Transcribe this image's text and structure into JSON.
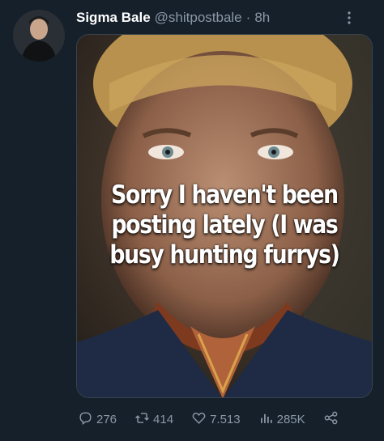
{
  "tweet": {
    "author_name": "Sigma Bale",
    "handle": "@shitpostbale",
    "separator": "·",
    "time": "8h",
    "media_caption": "Sorry I haven't been posting lately (I was busy hunting furrys)"
  },
  "actions": {
    "replies": "276",
    "retweets": "414",
    "likes": "7.513",
    "views": "285K"
  },
  "icons": {
    "more": "more-options-icon",
    "reply": "reply-icon",
    "retweet": "retweet-icon",
    "like": "like-icon",
    "views": "views-icon",
    "share": "share-icon"
  },
  "colors": {
    "background": "#15202b",
    "secondary_text": "#8b98a5",
    "primary_text": "#ffffff"
  }
}
